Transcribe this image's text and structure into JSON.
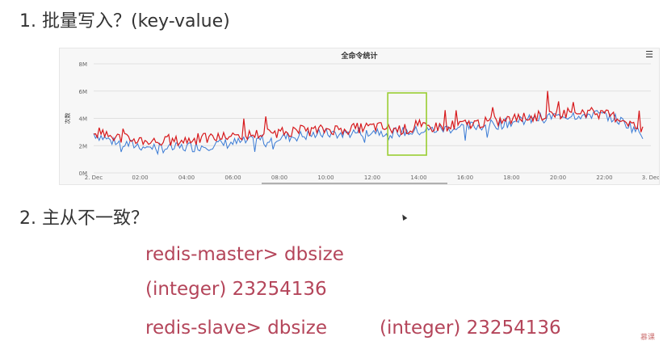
{
  "headings": {
    "q1": "1. 批量写入？(key-value)",
    "q2": "2. 主从不一致？"
  },
  "commands": {
    "line1": "redis-master> dbsize",
    "line2": "(integer) 23254136",
    "line3": "redis-slave> dbsize",
    "line4": "(integer) 23254136"
  },
  "logo_text": "慕课",
  "chart_data": {
    "type": "line",
    "title": "全命令统计",
    "ylabel": "次数",
    "ylim": [
      0,
      8
    ],
    "y_ticks": [
      "0M",
      "2M",
      "4M",
      "6M",
      "8M"
    ],
    "x_ticks": [
      "2. Dec",
      "02:00",
      "04:00",
      "06:00",
      "08:00",
      "10:00",
      "12:00",
      "14:00",
      "16:00",
      "18:00",
      "20:00",
      "22:00",
      "3. Dec"
    ],
    "grid": true,
    "series": [
      {
        "color": "#3a7bd5",
        "values": [
          2.9,
          2.4,
          2.1,
          2.0,
          1.9,
          1.8,
          1.9,
          2.0,
          2.1,
          2.2,
          2.3,
          2.5,
          2.6,
          2.7,
          2.8,
          2.9,
          2.9,
          3.0,
          3.1,
          3.0,
          3.0,
          3.1,
          3.2,
          3.3,
          3.4,
          3.5,
          3.6,
          3.8,
          3.9,
          4.1,
          4.2,
          4.3,
          4.3,
          4.1,
          3.6,
          2.8
        ]
      },
      {
        "color": "#d7191c",
        "values": [
          3.1,
          2.7,
          2.5,
          2.4,
          2.3,
          2.3,
          2.4,
          2.5,
          2.6,
          2.7,
          2.8,
          2.9,
          3.0,
          3.1,
          3.1,
          3.2,
          3.2,
          3.3,
          3.4,
          3.2,
          3.2,
          3.3,
          3.4,
          3.5,
          3.6,
          3.7,
          3.8,
          4.0,
          4.1,
          4.3,
          4.4,
          4.5,
          4.4,
          4.2,
          3.8,
          3.0
        ]
      }
    ],
    "highlight_box": {
      "x_start": "12:40",
      "x_end": "14:20",
      "color": "#9acd32"
    }
  }
}
